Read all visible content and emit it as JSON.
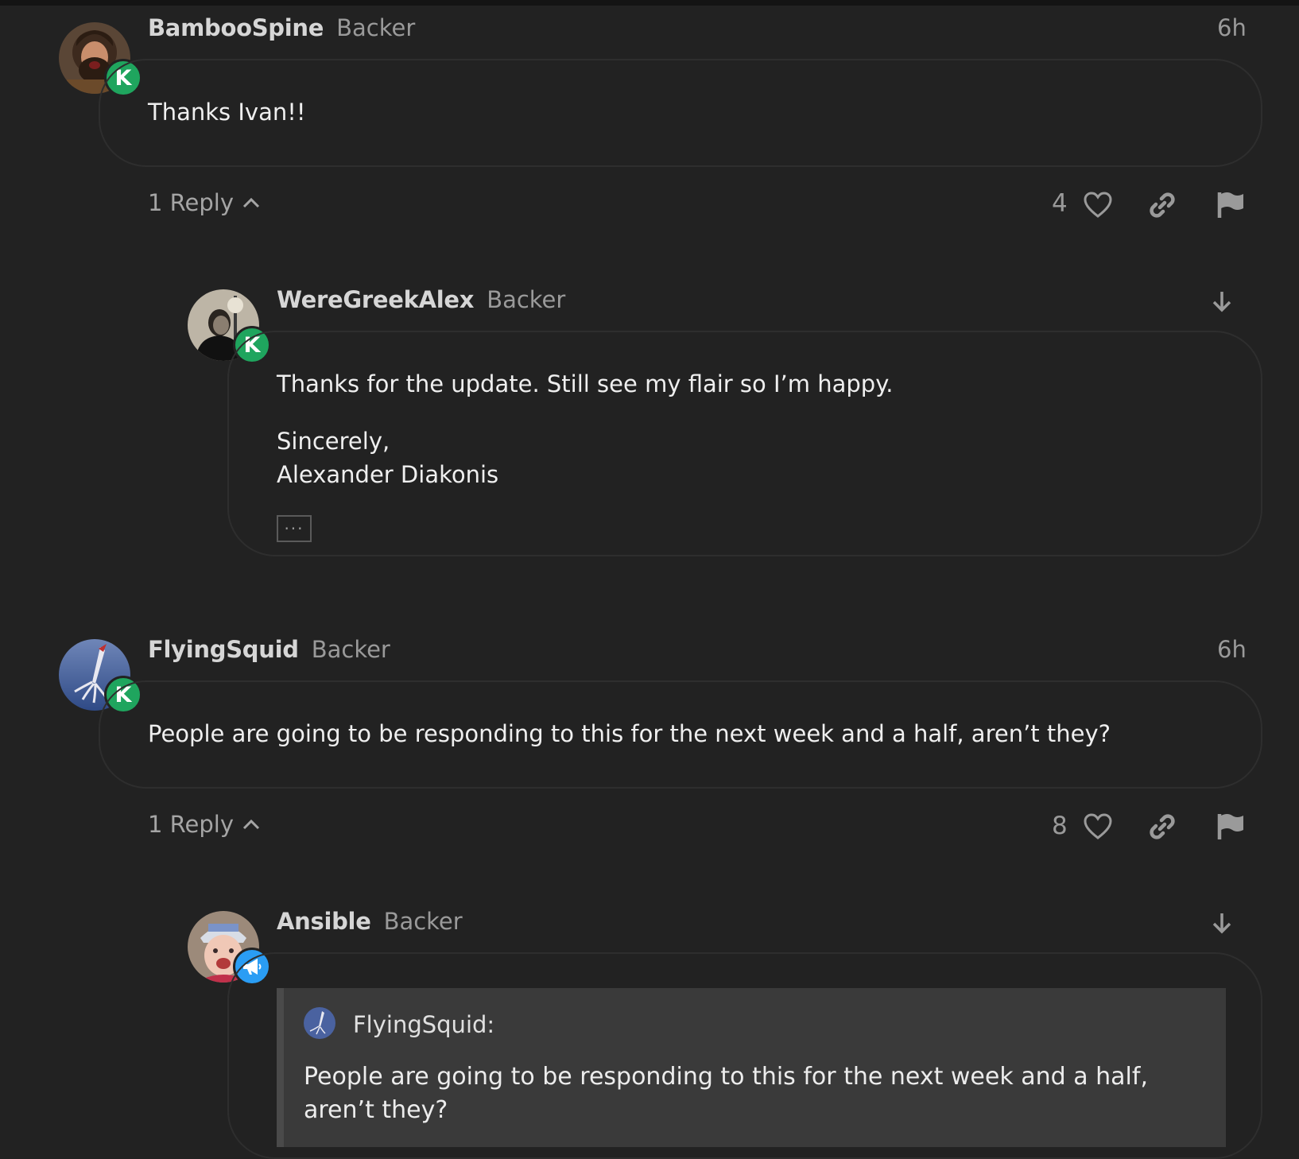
{
  "posts": [
    {
      "username": "BambooSpine",
      "role": "Backer",
      "time": "6h",
      "badge": "K",
      "body": [
        "Thanks Ivan!!"
      ],
      "replies_label": "1 Reply",
      "likes": "4"
    },
    {
      "username": "WereGreekAlex",
      "role": "Backer",
      "badge": "K",
      "body": [
        "Thanks for the update. Still see my flair so I’m happy.",
        "Sincerely,",
        "Alexander Diakonis"
      ],
      "ellipsis": "···"
    },
    {
      "username": "FlyingSquid",
      "role": "Backer",
      "time": "6h",
      "badge": "K",
      "body": [
        "People are going to be responding to this for the next week and a half, aren’t they?"
      ],
      "replies_label": "1 Reply",
      "likes": "8"
    },
    {
      "username": "Ansible",
      "role": "Backer",
      "badge_icon": "megaphone-icon",
      "quote": {
        "author": "FlyingSquid:",
        "text": "People are going to be responding to this for the next week and a half, aren’t they?"
      }
    }
  ],
  "colors": {
    "background": "#222222",
    "badge_green": "#1fa55e",
    "badge_blue": "#2a9df4"
  }
}
